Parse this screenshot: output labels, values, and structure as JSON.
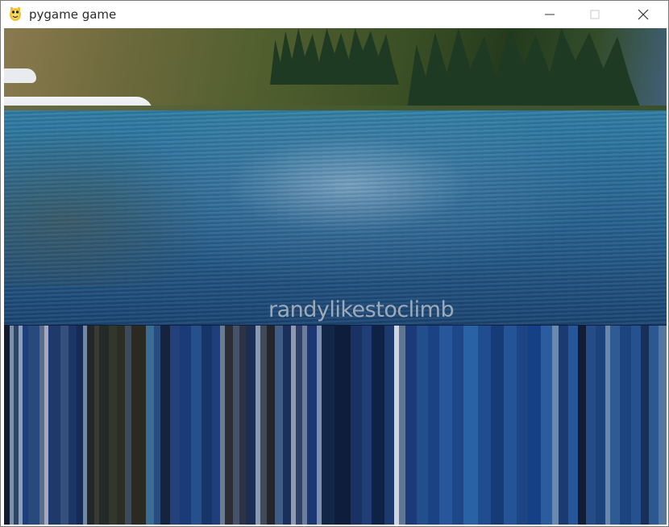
{
  "window": {
    "title": "pygame game",
    "icons": {
      "app": "pygame-snake-icon",
      "minimize": "minimize-icon",
      "maximize": "maximize-icon",
      "close": "close-icon"
    }
  },
  "game": {
    "overlay_text": "randylikestoclimb"
  },
  "colors": {
    "caption": "#9eaab8",
    "titlebar": "#ffffff"
  }
}
